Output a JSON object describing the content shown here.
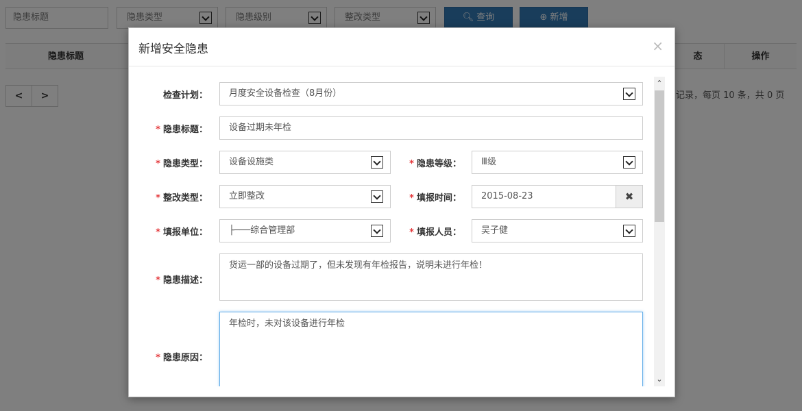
{
  "toolbar": {
    "search_placeholder": "隐患标题",
    "type_select": "隐患类型",
    "level_select": "隐患级别",
    "rectify_select": "整改类型",
    "query_label": "查询",
    "add_label": "新增"
  },
  "table": {
    "headers": [
      "隐患标题",
      "态",
      "操作"
    ]
  },
  "pager": {
    "prev": "<",
    "next": ">",
    "info": "记录，每页 10 条，共 0 页"
  },
  "modal": {
    "title": "新增安全隐患",
    "close": "×",
    "fields": {
      "plan": {
        "label": "检查计划：",
        "value": "月度安全设备检查（8月份）"
      },
      "title": {
        "label": "隐患标题：",
        "value": "设备过期未年检"
      },
      "type": {
        "label": "隐患类型：",
        "value": "设备设施类"
      },
      "level": {
        "label": "隐患等级：",
        "value": "Ⅲ级"
      },
      "rectify": {
        "label": "整改类型：",
        "value": "立即整改"
      },
      "report_time": {
        "label": "填报时间：",
        "value": "2015-08-23"
      },
      "unit": {
        "label": "填报单位：",
        "value": "├───综合管理部"
      },
      "reporter": {
        "label": "填报人员：",
        "value": "吴子健"
      },
      "description": {
        "label": "隐患描述：",
        "value": "货运一部的设备过期了，但未发现有年检报告，说明未进行年检！"
      },
      "cause": {
        "label": "隐患原因：",
        "value": "年检时，未对该设备进行年检"
      }
    },
    "required_mark": "*",
    "clear_icon": "✖"
  },
  "colors": {
    "primary": "#337ab7",
    "required": "#e4393c",
    "focus": "#66afe9"
  }
}
